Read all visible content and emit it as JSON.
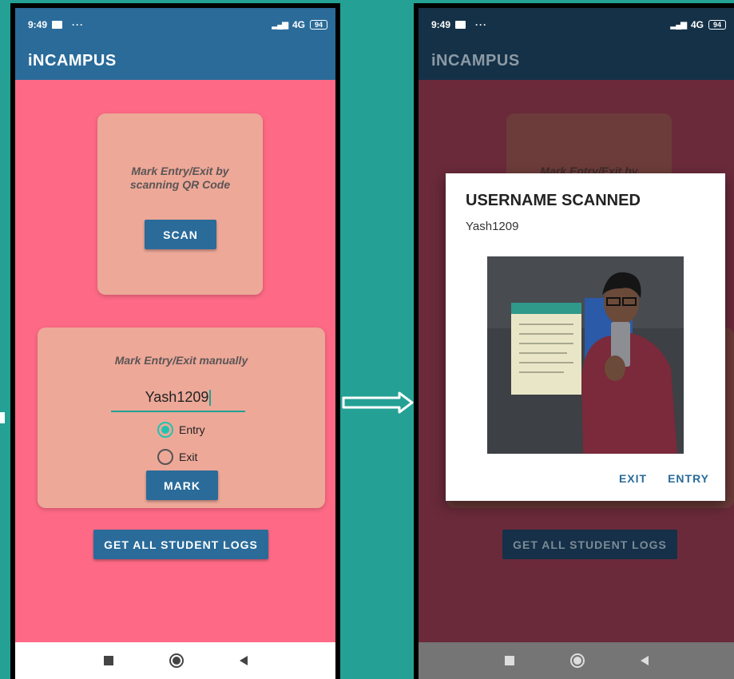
{
  "left_screen": {
    "status": {
      "time": "9:49",
      "dots": "···",
      "network": "4G",
      "battery": "94"
    },
    "app_title": "iNCAMPUS",
    "scan_card": {
      "text": "Mark Entry/Exit by scanning QR Code",
      "button": "SCAN"
    },
    "manual_card": {
      "text": "Mark Entry/Exit manually",
      "username_value": "Yash1209",
      "radio_entry": "Entry",
      "radio_exit": "Exit",
      "selected": "Entry",
      "button": "MARK"
    },
    "logs_button": "GET ALL STUDENT LOGS"
  },
  "right_screen": {
    "status": {
      "time": "9:49",
      "dots": "···",
      "network": "4G",
      "battery": "94"
    },
    "app_title": "iNCAMPUS",
    "scan_card_text": "Mark Entry/Exit by",
    "logs_button": "GET ALL STUDENT LOGS",
    "dialog": {
      "title": "USERNAME SCANNED",
      "message": "Yash1209",
      "photo_alt": "user-photo",
      "action_exit": "EXIT",
      "action_entry": "ENTRY"
    }
  },
  "colors": {
    "background": "#24a194",
    "appbar": "#2a6b9a",
    "screen": "#fe6a86",
    "card": "#eda898",
    "accent": "#23c2b0"
  }
}
